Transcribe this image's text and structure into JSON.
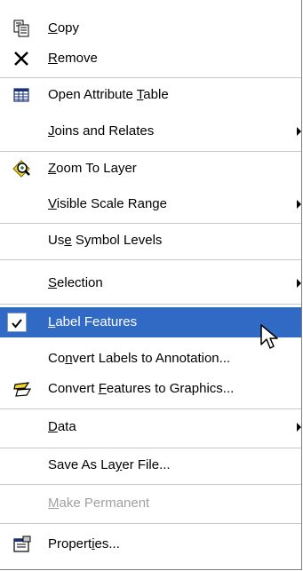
{
  "menu": {
    "items": [
      {
        "key": "copy",
        "mnemonic": "C",
        "rest": "opy",
        "icon": "copy-icon"
      },
      {
        "key": "remove",
        "mnemonic": "R",
        "rest": "emove",
        "icon": "remove-x-icon"
      },
      {
        "key": "open_attr",
        "pre": "Open Attribute ",
        "mnemonic": "T",
        "rest": "able",
        "icon": "attribute-table-icon"
      },
      {
        "key": "joins",
        "mnemonic": "J",
        "rest": "oins and Relates"
      },
      {
        "key": "zoom",
        "mnemonic": "Z",
        "rest": "oom To Layer",
        "icon": "zoom-to-layer-icon"
      },
      {
        "key": "scale",
        "mnemonic": "V",
        "rest": "isible Scale Range"
      },
      {
        "key": "symbol",
        "pre": "Us",
        "mnemonic": "e",
        "rest": " Symbol Levels"
      },
      {
        "key": "selection",
        "mnemonic": "S",
        "rest": "election"
      },
      {
        "key": "label",
        "mnemonic": "L",
        "rest": "abel Features"
      },
      {
        "key": "convert_labels",
        "pre": "Co",
        "mnemonic": "n",
        "rest": "vert Labels to Annotation..."
      },
      {
        "key": "convert_features",
        "pre": "Convert ",
        "mnemonic": "F",
        "rest": "eatures to Graphics...",
        "icon": "convert-to-graphics-icon"
      },
      {
        "key": "data",
        "mnemonic": "D",
        "rest": "ata"
      },
      {
        "key": "save_layer",
        "pre": "Save As La",
        "mnemonic": "y",
        "rest": "er File..."
      },
      {
        "key": "make_permanent",
        "mnemonic": "M",
        "rest": "ake Permanent"
      },
      {
        "key": "properties",
        "pre": "Propert",
        "mnemonic": "i",
        "rest": "es...",
        "icon": "properties-icon"
      }
    ]
  },
  "colors": {
    "highlight": "#316ac5",
    "disabled_text": "#a0a0a0",
    "separator": "#c8c8c8"
  }
}
